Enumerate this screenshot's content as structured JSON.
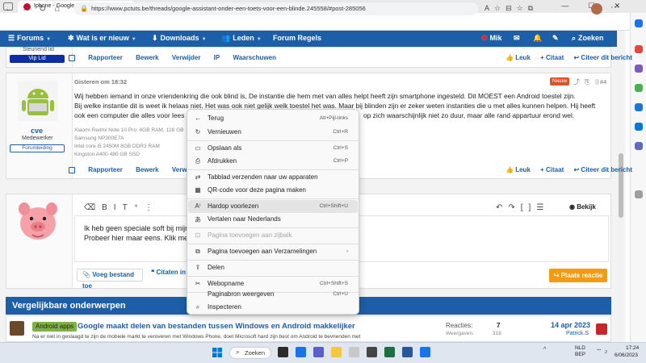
{
  "browser": {
    "tab_title": "Iphone - Google Assistant onde",
    "url": "https://www.pctuts.be/threads/google-assistant-onder-een-toets-voor-een-blinde.245558/#post-285056"
  },
  "forum_nav": {
    "forums": "Forums",
    "whats_new": "Wat is er nieuw",
    "downloads": "Downloads",
    "members": "Leden",
    "rules": "Forum Regels",
    "user": "Mik",
    "search": "Zoeken"
  },
  "prev_post": {
    "user_status": "Steunend lid",
    "vip_badge": "Vip Lid",
    "actions": [
      "Rapporteer",
      "Bewerk",
      "Verwijder",
      "IP",
      "Waarschuwen"
    ],
    "right_actions": [
      "Leuk",
      "+ Citaat",
      "Citeer dit bericht"
    ]
  },
  "post": {
    "date": "Gisteren om 18:32",
    "new_badge": "Nieuw",
    "number": "#4",
    "username": "cve",
    "user_title": "Medewerker",
    "user_badge": "Forumleiding",
    "lines": [
      "Wij hebben iemand in onze vriendenkring die ook blind is, De instantie die hem met van alles helpt heeft zijn smartphone ingesteld. Dit MOEST een Android toestel zijn.",
      "Bij welke instantie dit is weet ik helaas niet. Het was ook niet gelijk welk toestel het was. Maar bij blinden zijn er zeker weten instanties die u met alles kunnen helpen. Hij heeft",
      "ook een computer die alles voor lees",
      "op zich waarschijnlijk niet zo duur, maar alle rand appartuur erond wel."
    ],
    "signature": [
      "Xiaomi Redmi Note 10 Pro: 6GB RAM, 128 GB",
      "Samsung NP300E7A",
      "Intel core i5 2450M 8GB DDR3 RAM",
      "Kingston A400 480 GB SSD"
    ],
    "actions": [
      "Rapporteer",
      "Bewerk",
      "Verwijder"
    ],
    "right_actions": [
      "Leuk",
      "+ Citaat",
      "Citeer dit bericht"
    ]
  },
  "editor": {
    "preview": "Bekijk",
    "text_line1": "Ik heb geen speciale soft bij mijn t",
    "text_line2": "Probeer hier maar eens. Klik met r",
    "attach": "Voeg bestand toe",
    "quotes": "Citaten in",
    "reply": "Plaats reactie"
  },
  "context_menu": {
    "items": [
      {
        "icon": "←",
        "label": "Terug",
        "shortcut": "Alt+Pijl-links"
      },
      {
        "icon": "↻",
        "label": "Vernieuwen",
        "shortcut": "Ctrl+R"
      },
      {
        "icon": "▭",
        "label": "Opslaan als",
        "shortcut": "Ctrl+S"
      },
      {
        "icon": "⎙",
        "label": "Afdrukken",
        "shortcut": "Ctrl+P"
      },
      {
        "icon": "⇄",
        "label": "Tabblad verzenden naar uw apparaten",
        "shortcut": ""
      },
      {
        "icon": "▦",
        "label": "QR-code voor deze pagina maken",
        "shortcut": ""
      },
      {
        "icon": "A⁾",
        "label": "Hardop voorlezen",
        "shortcut": "Ctrl+Shift+U"
      },
      {
        "icon": "あ",
        "label": "Vertalen naar Nederlands",
        "shortcut": ""
      },
      {
        "icon": "⊡",
        "label": "Pagina toevoegen aan zijbalk",
        "shortcut": ""
      },
      {
        "icon": "⧉",
        "label": "Pagina toevoegen aan Verzamelingen",
        "shortcut": "›"
      },
      {
        "icon": "⇪",
        "label": "Delen",
        "shortcut": ""
      },
      {
        "icon": "✂",
        "label": "Webopname",
        "shortcut": "Ctrl+Shift+S"
      },
      {
        "icon": "",
        "label": "Paginabron weergeven",
        "shortcut": "Ctrl+U"
      },
      {
        "icon": "⌕",
        "label": "Inspecteren",
        "shortcut": ""
      }
    ]
  },
  "similar": {
    "heading": "Vergelijkbare onderwerpen",
    "tag": "Android apps",
    "title": "Google maakt delen van bestanden tussen Windows en Android makkelijker",
    "subtitle": "Na er niet in geslaagd te zijn de mobiele markt te veroveren met Windows Phone, doet Microsoft hard zijn best om Android te bevrienden met",
    "reactions_label": "Reacties:",
    "reactions_value": "7",
    "views_label": "Weergaven:",
    "views_value": "318",
    "date": "14 apr 2023",
    "author": "Patrick.S"
  },
  "taskbar": {
    "search": "Zoeken",
    "lang1": "NLD",
    "lang2": "BEP",
    "time": "17:24",
    "date": "6/06/2023"
  },
  "colors": {
    "nav_blue": "#1d5ea8",
    "new_badge": "#d9532c",
    "reply_orange": "#f39c12",
    "android_tag": "#7cb342",
    "vip_badge": "#0d2ea3"
  }
}
